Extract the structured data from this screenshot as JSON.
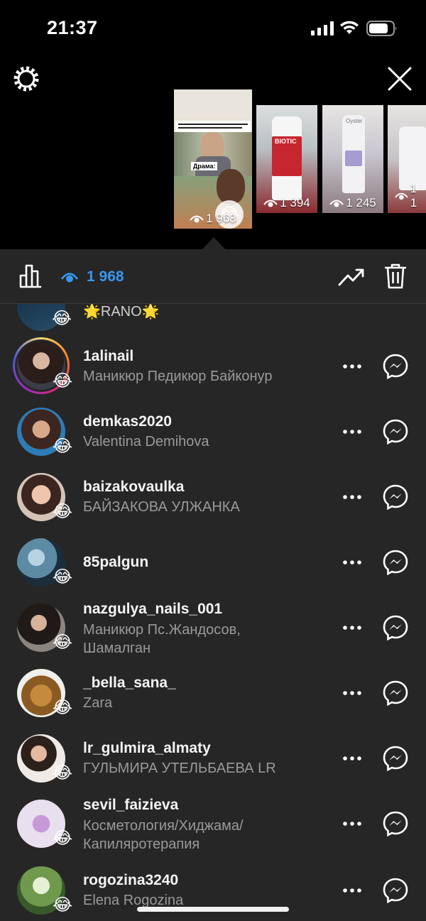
{
  "status_bar": {
    "time": "21:37"
  },
  "story": {
    "thumbnails": [
      {
        "views": "1 968",
        "selected": true,
        "caption": "Я смотрю драму о семейной жизни. Плачу и сопереживаю главной героине:",
        "sub_label": "Драма:"
      },
      {
        "views": "1 394",
        "label": "BIOTIC"
      },
      {
        "views": "1 245",
        "label": "Oyster"
      },
      {
        "views": "1 1"
      }
    ]
  },
  "toolbar": {
    "view_count": "1 968"
  },
  "viewers": [
    {
      "username": "",
      "full_name": "🌟RANO🌟",
      "reaction": "😂"
    },
    {
      "username": "1alinail",
      "full_name": "Маникюр Педикюр Байконур",
      "reaction": "😂",
      "has_story_ring": true
    },
    {
      "username": "demkas2020",
      "full_name": "Valentina Demihova",
      "reaction": "😂"
    },
    {
      "username": "baizakovaulka",
      "full_name": "БАЙЗАКОВА УЛЖАНКА",
      "reaction": "😂"
    },
    {
      "username": "85palgun",
      "full_name": "",
      "reaction": "😂"
    },
    {
      "username": "nazgulya_nails_001",
      "full_name": "Маникюр Пс.Жандосов, Шамалган",
      "reaction": "😂"
    },
    {
      "username": "_bella_sana_",
      "full_name": "Zara",
      "reaction": "😂"
    },
    {
      "username": "lr_gulmira_almaty",
      "full_name": "ГУЛЬМИРА УТЕЛЬБАЕВА LR",
      "reaction": "😂"
    },
    {
      "username": "sevil_faizieva",
      "full_name": "Косметология/Хиджама/ Капиляротерапия",
      "reaction": "😂"
    },
    {
      "username": "rogozina3240",
      "full_name": "Elena Rogozina",
      "reaction": "😂"
    }
  ],
  "colors": {
    "accent": "#3897f0",
    "panel": "#262626",
    "secondary_text": "#9a9a9a"
  },
  "icons": [
    "gear-icon",
    "close-icon",
    "insights-icon",
    "eye-icon",
    "trending-icon",
    "trash-icon",
    "more-icon",
    "messenger-icon"
  ]
}
